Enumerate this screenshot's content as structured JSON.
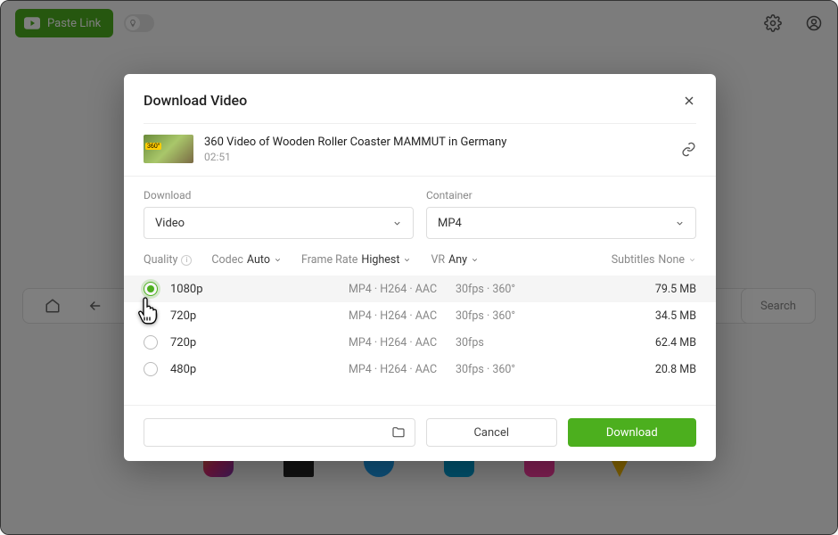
{
  "topbar": {
    "paste_label": "Paste Link"
  },
  "browser": {
    "search_label": "Search"
  },
  "modal": {
    "title": "Download Video",
    "video": {
      "title": "360 Video of Wooden Roller Coaster MAMMUT in Germany",
      "duration": "02:51"
    },
    "download_label": "Download",
    "download_value": "Video",
    "container_label": "Container",
    "container_value": "MP4",
    "filters": {
      "quality_label": "Quality",
      "codec_label": "Codec",
      "codec_value": "Auto",
      "framerate_label": "Frame Rate",
      "framerate_value": "Highest",
      "vr_label": "VR",
      "vr_value": "Any",
      "subtitles_label": "Subtitles",
      "subtitles_value": "None"
    },
    "rows": [
      {
        "res": "1080p",
        "fmt": "MP4 · H264 · AAC",
        "extra": "30fps · 360°",
        "size": "79.5 MB",
        "selected": true
      },
      {
        "res": "720p",
        "fmt": "MP4 · H264 · AAC",
        "extra": "30fps · 360°",
        "size": "34.5 MB",
        "selected": false
      },
      {
        "res": "720p",
        "fmt": "MP4 · H264 · AAC",
        "extra": "30fps",
        "size": "62.4 MB",
        "selected": false
      },
      {
        "res": "480p",
        "fmt": "MP4 · H264 · AAC",
        "extra": "30fps · 360°",
        "size": "20.8 MB",
        "selected": false
      }
    ],
    "cancel_label": "Cancel",
    "dl_btn_label": "Download"
  }
}
